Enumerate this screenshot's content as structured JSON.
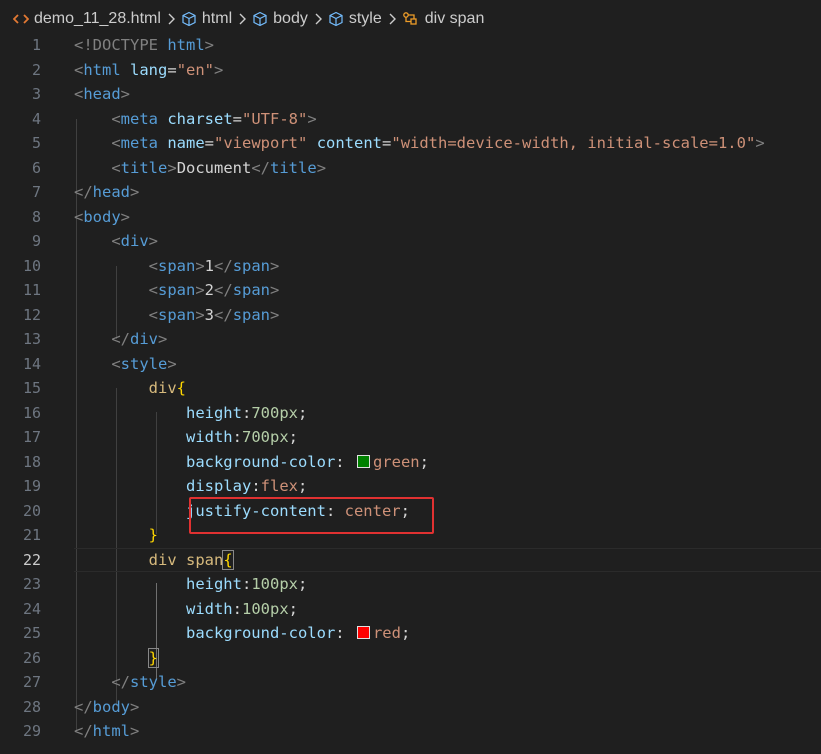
{
  "breadcrumb": {
    "file": "demo_11_28.html",
    "items": [
      "html",
      "body",
      "style",
      "div span"
    ]
  },
  "line_numbers": [
    "1",
    "2",
    "3",
    "4",
    "5",
    "6",
    "7",
    "8",
    "9",
    "10",
    "11",
    "12",
    "13",
    "14",
    "15",
    "16",
    "17",
    "18",
    "19",
    "20",
    "21",
    "22",
    "23",
    "24",
    "25",
    "26",
    "27",
    "28",
    "29"
  ],
  "active_line": "22",
  "code": {
    "l1_doctype": "<!DOCTYPE",
    "l1_html": "html",
    "l2_tag": "html",
    "l2_attr": "lang",
    "l2_val": "\"en\"",
    "l3_tag": "head",
    "l4_tag": "meta",
    "l4_attr": "charset",
    "l4_val": "\"UTF-8\"",
    "l5_tag": "meta",
    "l5_attr1": "name",
    "l5_val1": "\"viewport\"",
    "l5_attr2": "content",
    "l5_val2": "\"width=device-width, initial-scale=1.0\"",
    "l6_tag": "title",
    "l6_text": "Document",
    "l7_tag": "head",
    "l8_tag": "body",
    "l9_tag": "div",
    "l10_tag": "span",
    "l10_text": "1",
    "l11_tag": "span",
    "l11_text": "2",
    "l12_tag": "span",
    "l12_text": "3",
    "l13_tag": "div",
    "l14_tag": "style",
    "l15_sel": "div",
    "l16_prop": "height",
    "l16_val": "700px",
    "l17_prop": "width",
    "l17_val": "700px",
    "l18_prop": "background-color",
    "l18_val": "green",
    "l18_color": "#008000",
    "l19_prop": "display",
    "l19_val": "flex",
    "l20_prop": "justify-content",
    "l20_val": "center",
    "l22_sel": "div span",
    "l23_prop": "height",
    "l23_val": "100px",
    "l24_prop": "width",
    "l24_val": "100px",
    "l25_prop": "background-color",
    "l25_val": "red",
    "l25_color": "#ff0000",
    "l27_tag": "style",
    "l28_tag": "body",
    "l29_tag": "html"
  },
  "colors": {
    "background": "#1f1f1f",
    "tag": "#569cd6",
    "attribute": "#9cdcfe",
    "string": "#ce9178",
    "selector": "#d7ba7d",
    "brace": "#ffd700",
    "number": "#b5cea8",
    "highlight_box": "#e03131"
  },
  "icons": {
    "file_icon": "html-file-icon",
    "element_icon": "cube-icon",
    "selector_icon": "symbol-class-icon",
    "separator": "chevron-right-icon"
  }
}
